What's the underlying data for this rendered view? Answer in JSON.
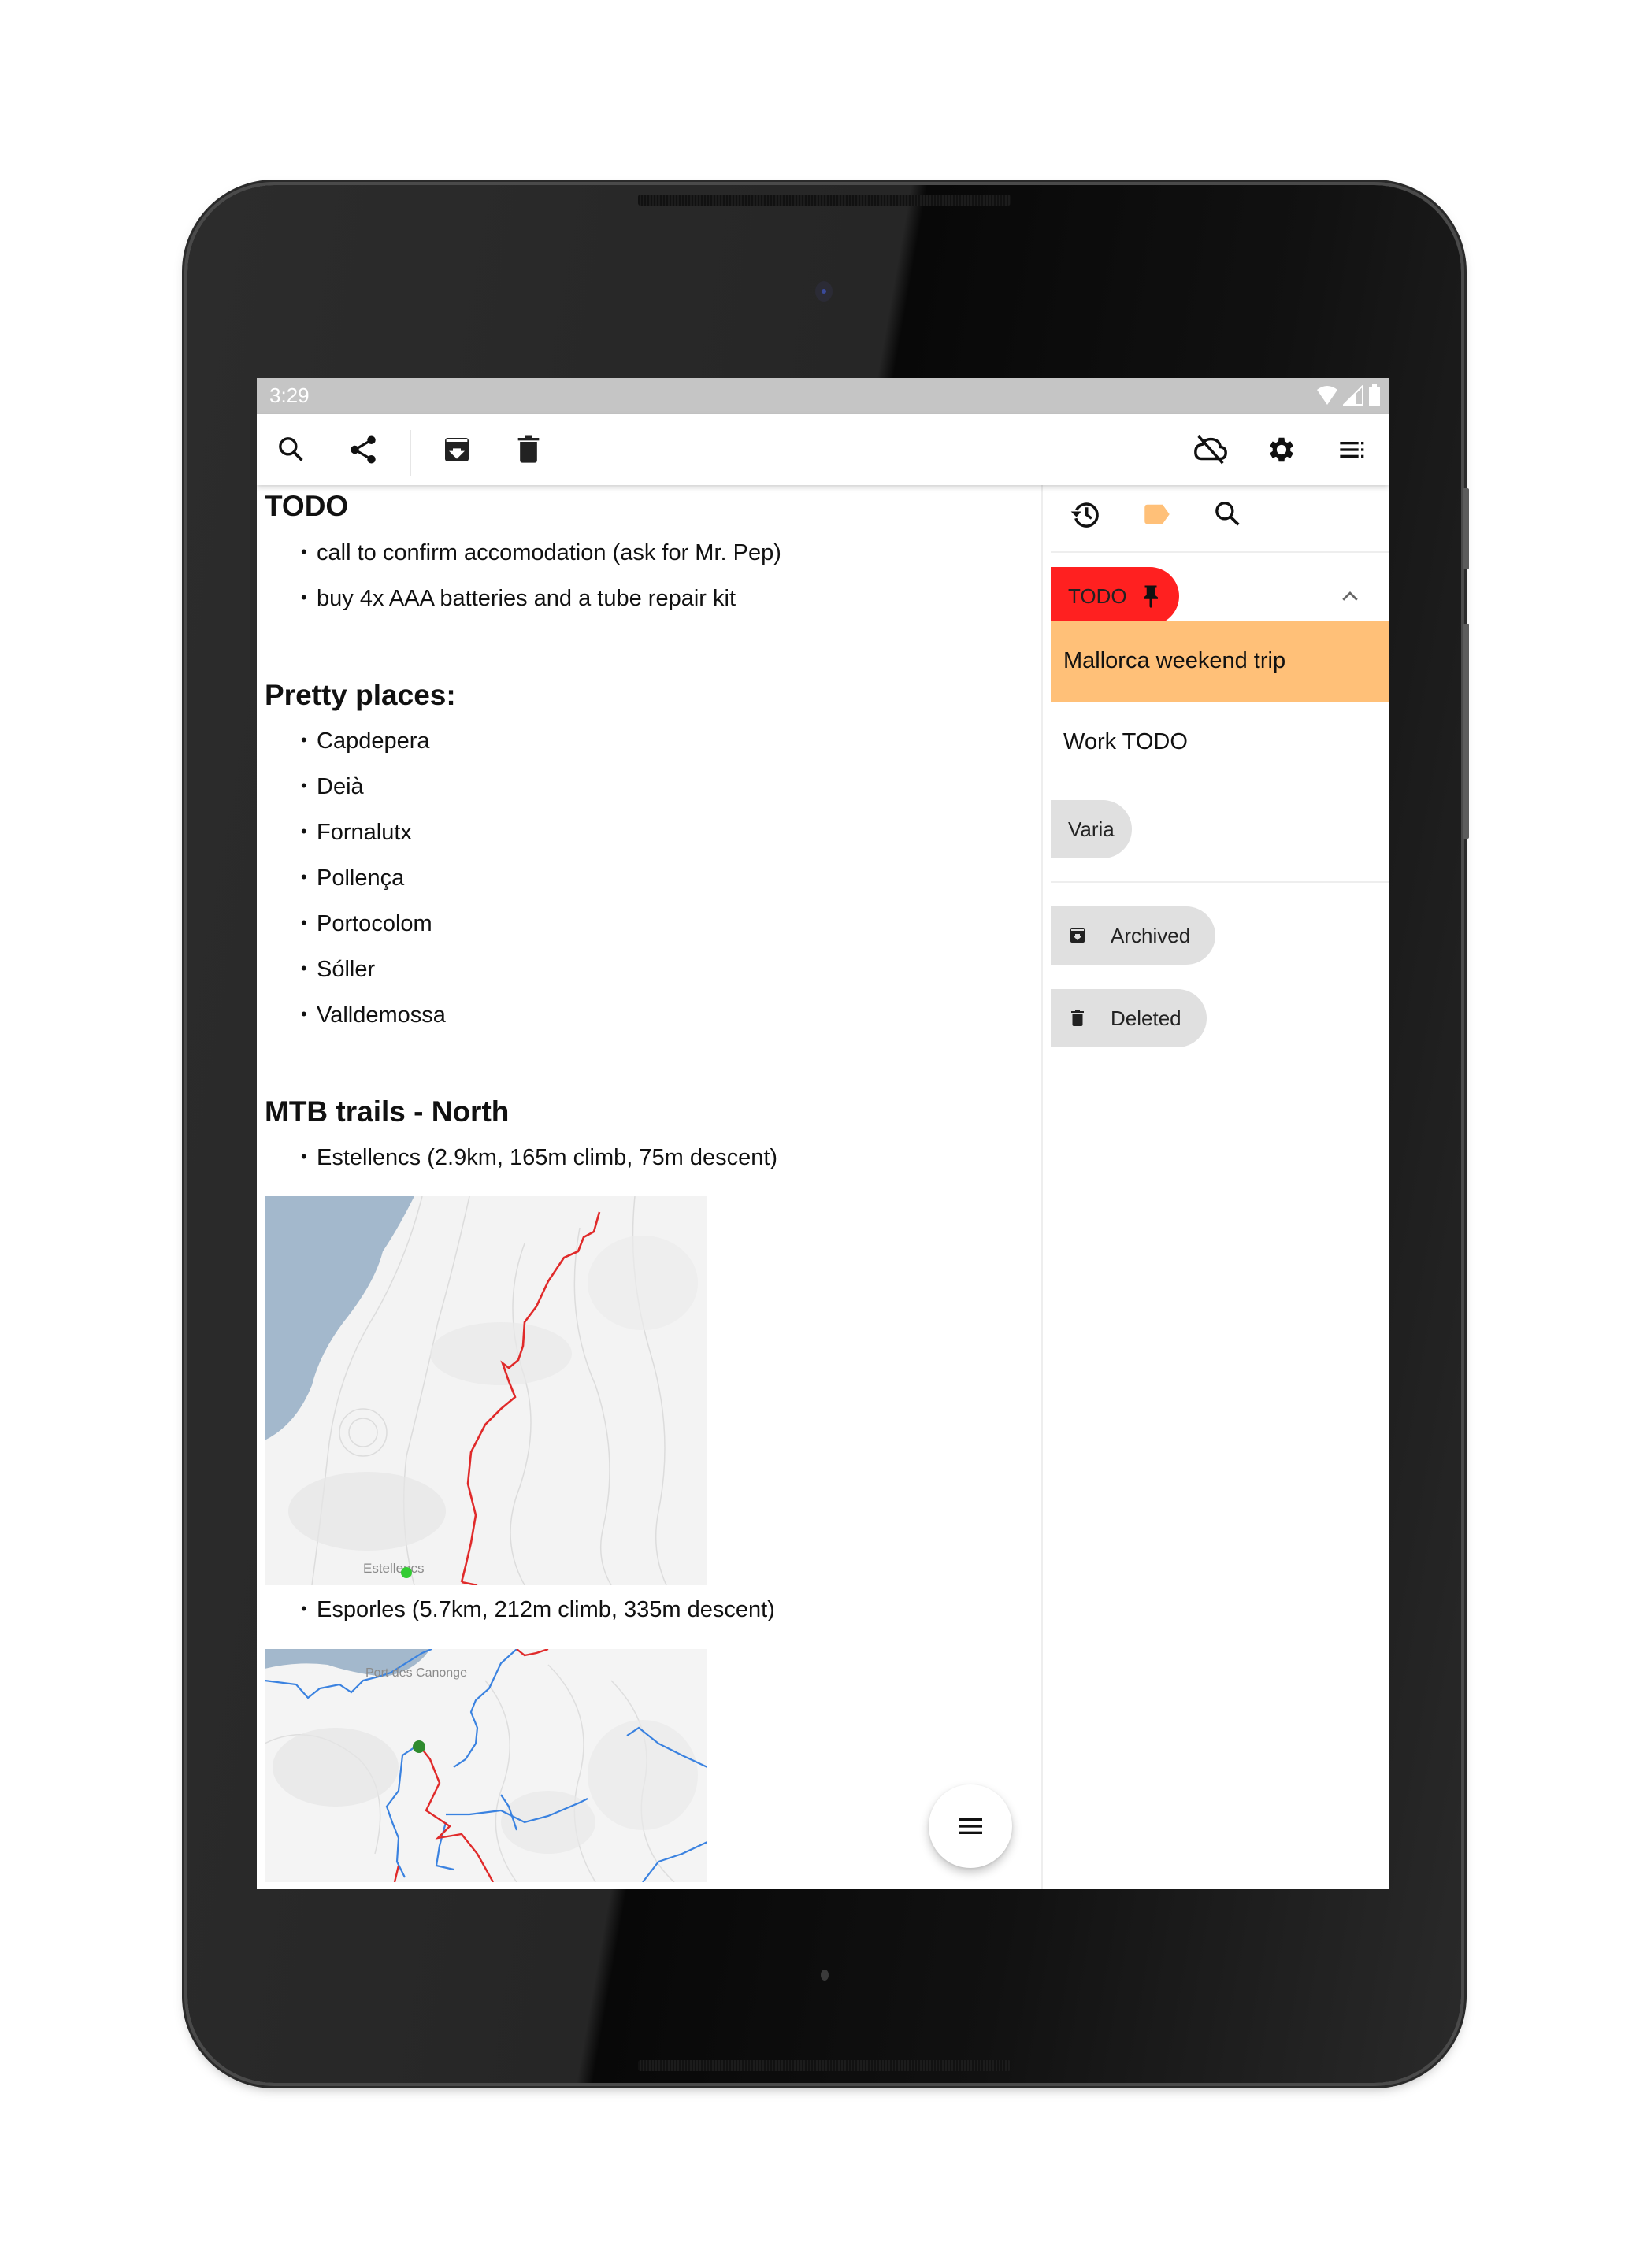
{
  "status_bar": {
    "time": "3:29",
    "icons": [
      "wifi-icon",
      "cell-signal-icon",
      "battery-icon"
    ]
  },
  "toolbar": {
    "left_icons": [
      "search-icon",
      "share-icon",
      "archive-icon",
      "delete-icon"
    ],
    "right_icons": [
      "cloud-off-icon",
      "settings-gear-icon",
      "list-menu-icon"
    ]
  },
  "note": {
    "sections": [
      {
        "heading": "TODO",
        "items": [
          "call to confirm accomodation (ask for Mr. Pep)",
          "buy 4x AAA batteries and a tube repair kit"
        ]
      },
      {
        "heading": "Pretty places:",
        "items": [
          "Capdepera",
          "Deià",
          "Fornalutx",
          "Pollença",
          "Portocolom",
          "Sóller",
          "Valldemossa"
        ]
      },
      {
        "heading": "MTB trails - North",
        "items": [
          "Estellencs (2.9km, 165m climb, 75m descent)",
          "Esporles (5.7km, 212m climb, 335m descent)"
        ]
      }
    ],
    "maps": [
      {
        "label": "Estellencs"
      },
      {
        "label": "Port des Canonge"
      }
    ],
    "bullet": "•"
  },
  "sidebar": {
    "header_icons": [
      "history-icon",
      "label-icon",
      "search-icon"
    ],
    "pinned_chip": {
      "label": "TODO",
      "color": "#ff2020"
    },
    "notes": [
      {
        "label": "Mallorca weekend trip",
        "selected": true,
        "color": "#ffc078"
      },
      {
        "label": "Work TODO",
        "selected": false
      }
    ],
    "varia_chip": {
      "label": "Varia"
    },
    "special": [
      {
        "label": "Archived",
        "icon": "archive-icon"
      },
      {
        "label": "Deleted",
        "icon": "delete-icon"
      }
    ]
  },
  "fab": {
    "icon": "menu-icon"
  },
  "colors": {
    "accent_label": "#ffc078",
    "pinned": "#ff2020",
    "chip_bg": "#e0e0e0",
    "status_bar": "#c5c5c5"
  }
}
